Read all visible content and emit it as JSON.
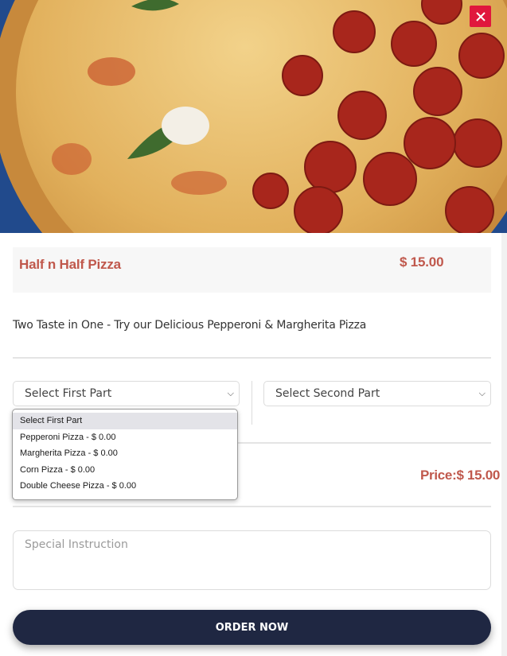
{
  "hero": {
    "image_alt": "Half and half pizza"
  },
  "close_icon": "close-icon",
  "item": {
    "name": "Half n Half Pizza",
    "price": "$ 15.00",
    "description": "Two Taste in One - Try our Delicious Pepperoni & Margherita Pizza"
  },
  "first_part": {
    "selected": "Select First Part",
    "options": [
      "Select First Part",
      "Pepperoni Pizza - $ 0.00",
      "Margherita Pizza - $ 0.00",
      "Corn Pizza - $ 0.00",
      "Double Cheese Pizza - $ 0.00"
    ]
  },
  "second_part": {
    "selected": "Select Second Part"
  },
  "total_price": "Price:$ 15.00",
  "special_instruction": {
    "placeholder": "Special Instruction"
  },
  "order_button": "ORDER NOW",
  "colors": {
    "accent": "#c0584c",
    "button": "#1f2742",
    "close": "#e0173d"
  }
}
